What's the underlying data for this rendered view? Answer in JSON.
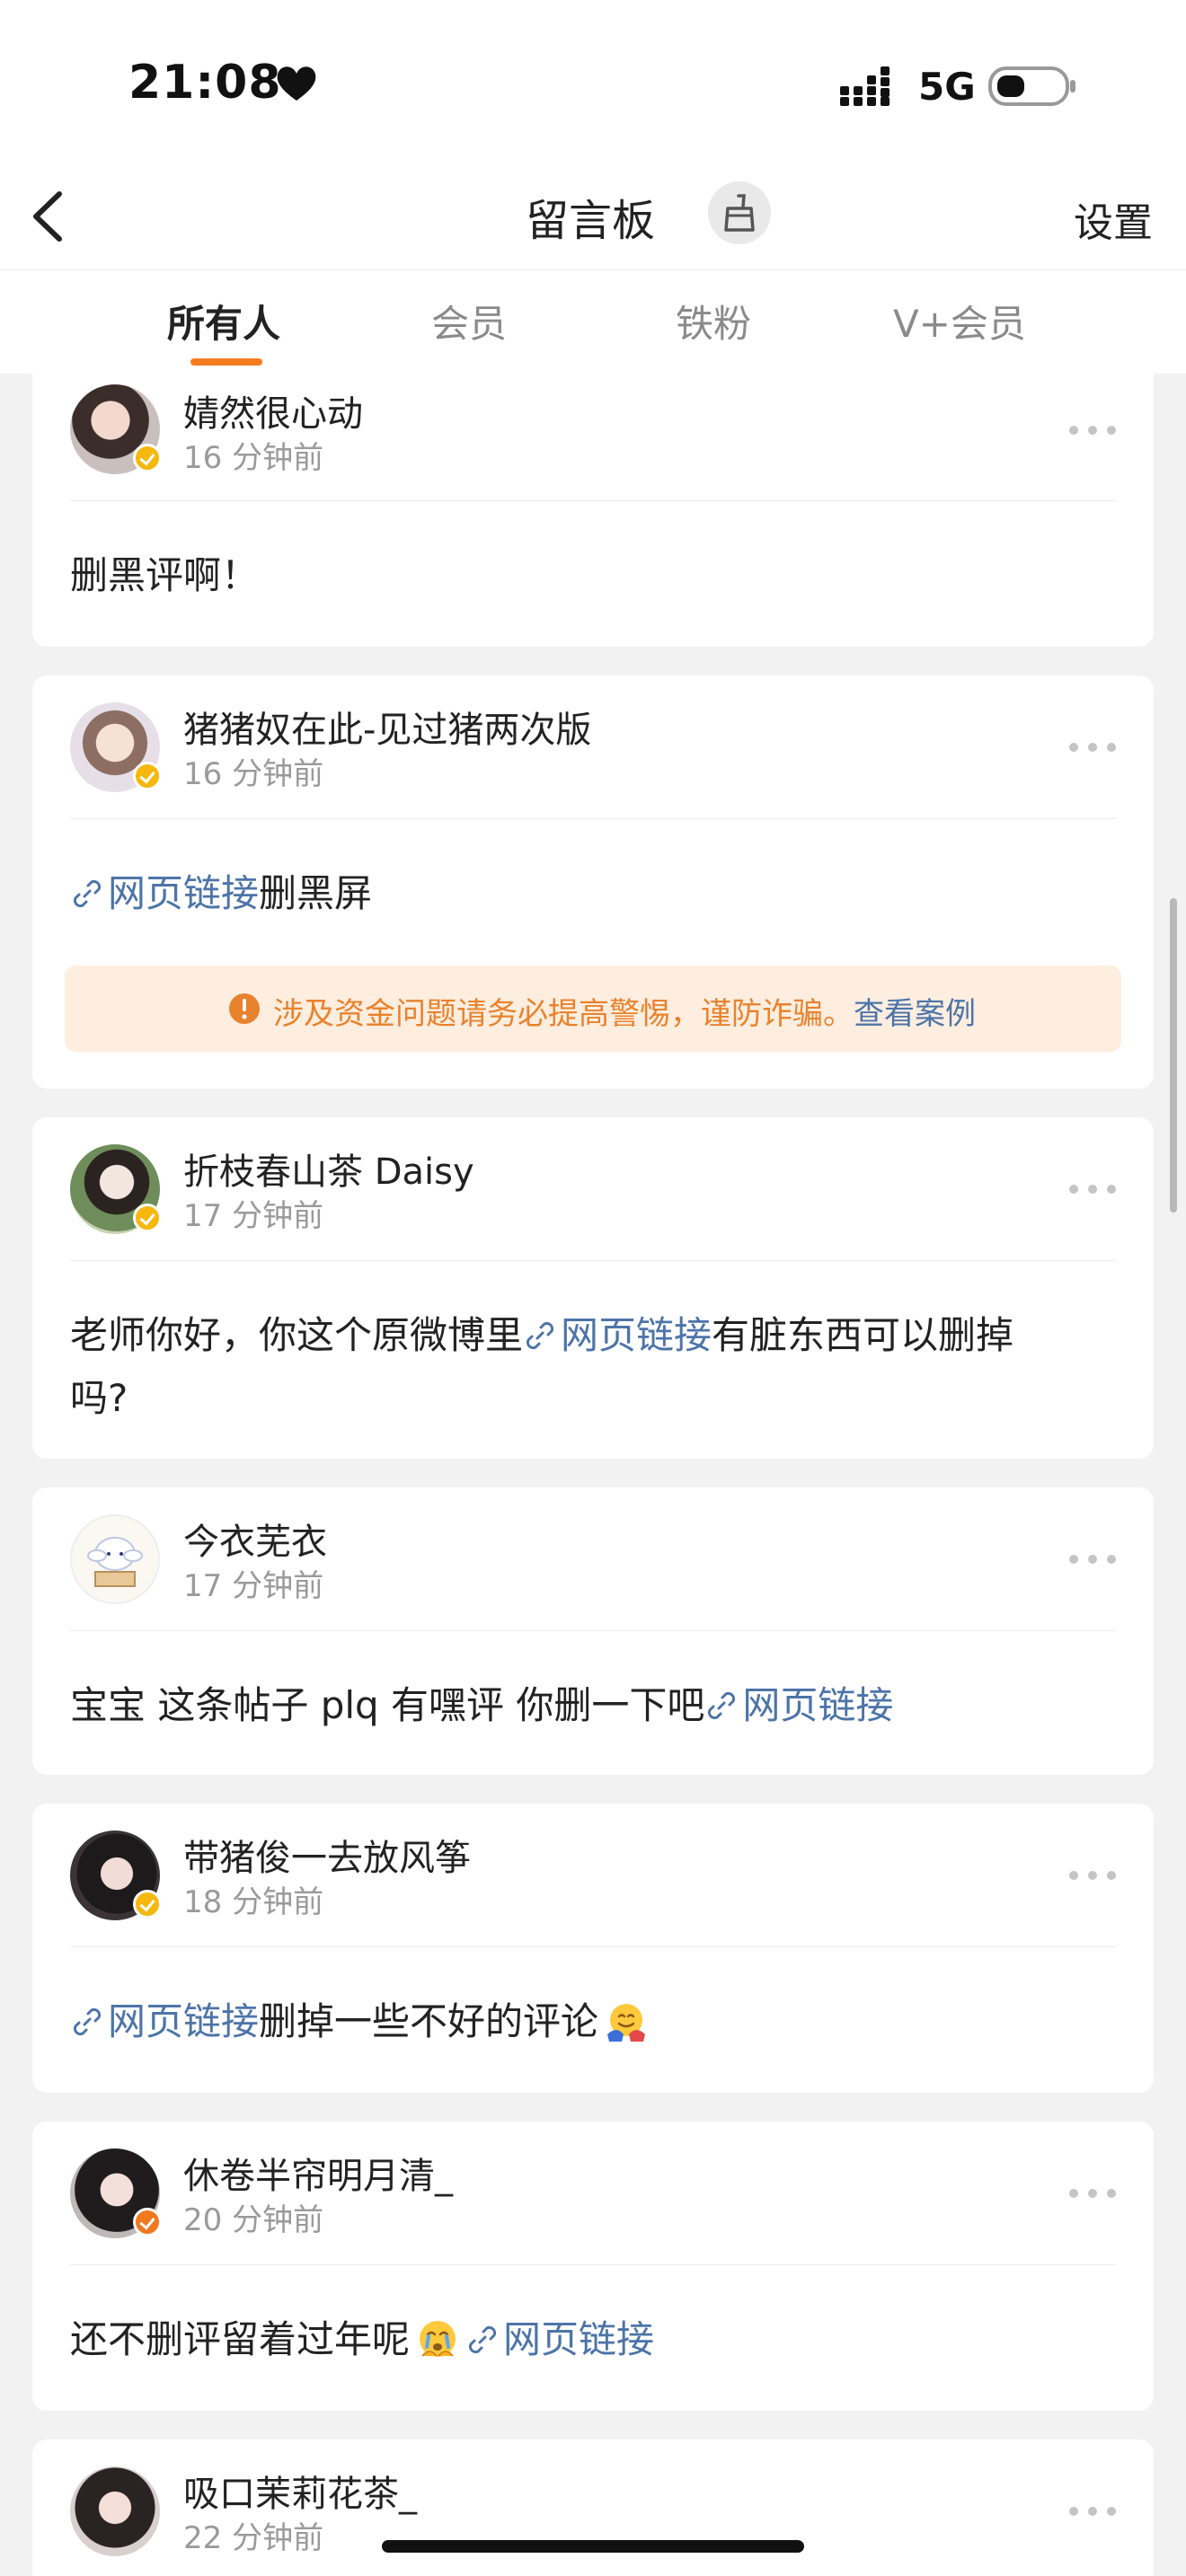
{
  "status_bar": {
    "time": "21:08",
    "network": "5G",
    "icons": [
      "heart-icon",
      "signal-icon",
      "battery-icon"
    ]
  },
  "nav": {
    "title": "留言板",
    "settings": "设置",
    "icons": [
      "back-icon",
      "broom-icon"
    ]
  },
  "tabs": [
    {
      "label": "所有人",
      "active": true
    },
    {
      "label": "会员",
      "active": false
    },
    {
      "label": "铁粉",
      "active": false
    },
    {
      "label": "V+会员",
      "active": false
    }
  ],
  "colors": {
    "accent": "#f57c1f",
    "link": "#4d74a8",
    "warning_bg": "#fdeee0",
    "warning_text": "#e9822d",
    "verify_gold": "#f6b80f",
    "verify_orange": "#f0781e"
  },
  "posts": [
    {
      "user": "婧然很心动",
      "time": "16 分钟前",
      "text": "删黑评啊！"
    },
    {
      "user": "猪猪奴在此-见过猪两次版",
      "time": "16 分钟前",
      "link": "网页链接",
      "text_after": "删黑屏",
      "warning": {
        "text": "涉及资金问题请务必提高警惕，谨防诈骗。",
        "link": "查看案例"
      }
    },
    {
      "user": "折枝春山茶 Daisy",
      "time": "17 分钟前",
      "text_before": "老师你好，你这个原微博里",
      "link": "网页链接",
      "text_after": "有脏东西可以删掉",
      "text_line2": "吗?"
    },
    {
      "user": "今衣芜衣",
      "time": "17 分钟前",
      "text_before": "宝宝 这条帖子 plq 有嘿评 你删一下吧",
      "link": "网页链接"
    },
    {
      "user": "带猪俊一去放风筝",
      "time": "18 分钟前",
      "link": "网页链接",
      "text_after": "删掉一些不好的评论"
    },
    {
      "user": "休卷半帘明月清_",
      "time": "20 分钟前",
      "text_before": "还不删评留着过年呢",
      "link": "网页链接"
    },
    {
      "user": "吸口茉莉花茶_",
      "time": "22 分钟前"
    }
  ]
}
